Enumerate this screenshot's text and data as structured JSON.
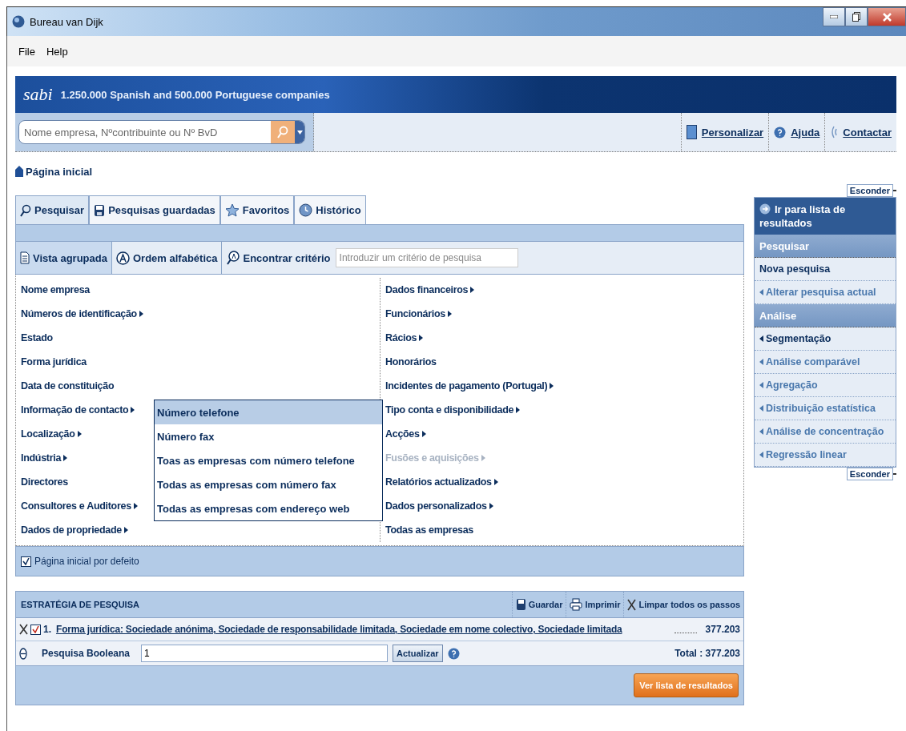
{
  "window": {
    "title": "Bureau van Dijk"
  },
  "menu": [
    "File",
    "Help"
  ],
  "banner": {
    "logo": "sabi",
    "tagline": "1.250.000 Spanish and 500.000 Portuguese companies"
  },
  "search": {
    "placeholder": "Nome empresa, Nºcontribuinte ou Nº BvD"
  },
  "header_links": [
    {
      "label": "Personalizar",
      "kind": "customize"
    },
    {
      "label": "Ajuda",
      "kind": "help"
    },
    {
      "label": "Contactar",
      "kind": "contact"
    }
  ],
  "breadcrumb": "Página inicial",
  "tabs": [
    {
      "label": "Pesquisar",
      "kind": "search",
      "selected": true
    },
    {
      "label": "Pesquisas guardadas",
      "kind": "saved",
      "selected": false
    },
    {
      "label": "Favoritos",
      "kind": "favorites",
      "selected": false
    },
    {
      "label": "Histórico",
      "kind": "history",
      "selected": false
    }
  ],
  "view_tabs": [
    {
      "label": "Vista agrupada",
      "kind": "grouped",
      "selected": true
    },
    {
      "label": "Ordem alfabética",
      "kind": "alpha",
      "selected": false
    }
  ],
  "find": {
    "label": "Encontrar critério",
    "placeholder": "Introduzir um critério de pesquisa"
  },
  "criteria_columns": [
    [
      {
        "label": "Nome empresa",
        "has_submenu": false,
        "disabled": false
      },
      {
        "label": "Números de identificação",
        "has_submenu": true,
        "disabled": false
      },
      {
        "label": "Estado",
        "has_submenu": false,
        "disabled": false
      },
      {
        "label": "Forma jurídica",
        "has_submenu": false,
        "disabled": false
      },
      {
        "label": "Data de constituição",
        "has_submenu": false,
        "disabled": false
      },
      {
        "label": "Informação de contacto",
        "has_submenu": true,
        "disabled": false,
        "submenu": [
          {
            "label": "Número telefone",
            "selected": true
          },
          {
            "label": "Número fax",
            "selected": false
          },
          {
            "label": "Toas as empresas com número telefone",
            "selected": false
          },
          {
            "label": "Todas as empresas com número fax",
            "selected": false
          },
          {
            "label": "Todas as empresas com endereço web",
            "selected": false
          }
        ]
      },
      {
        "label": "Localização",
        "has_submenu": true,
        "disabled": false
      },
      {
        "label": "Indústria",
        "has_submenu": true,
        "disabled": false
      },
      {
        "label": "Directores",
        "has_submenu": false,
        "disabled": false
      },
      {
        "label": "Consultores e Auditores",
        "has_submenu": true,
        "disabled": false
      },
      {
        "label": "Dados de propriedade",
        "has_submenu": true,
        "disabled": false
      }
    ],
    [
      {
        "label": "Dados financeiros",
        "has_submenu": true,
        "disabled": false
      },
      {
        "label": "Funcionários",
        "has_submenu": true,
        "disabled": false
      },
      {
        "label": "Rácios",
        "has_submenu": true,
        "disabled": false
      },
      {
        "label": "Honorários",
        "has_submenu": false,
        "disabled": false
      },
      {
        "label": "Incidentes de pagamento (Portugal)",
        "has_submenu": true,
        "disabled": false
      },
      {
        "label": "Tipo conta e disponibilidade",
        "has_submenu": true,
        "disabled": false
      },
      {
        "label": "Acções",
        "has_submenu": true,
        "disabled": false
      },
      {
        "label": "Fusões e aquisições",
        "has_submenu": true,
        "disabled": true
      },
      {
        "label": "Relatórios actualizados",
        "has_submenu": true,
        "disabled": false
      },
      {
        "label": "Dados personalizados",
        "has_submenu": true,
        "disabled": false
      },
      {
        "label": "Todas as empresas",
        "has_submenu": false,
        "disabled": false
      }
    ]
  ],
  "default_home": {
    "label": "Página inicial por defeito",
    "checked": true
  },
  "strategy": {
    "title": "ESTRATÉGIA DE PESQUISA",
    "actions": [
      {
        "label": "Guardar",
        "kind": "save"
      },
      {
        "label": "Imprimir",
        "kind": "print"
      },
      {
        "label": "Limpar todos os passos",
        "kind": "clear"
      }
    ],
    "steps": [
      {
        "number": "1.",
        "text": "Forma jurídica: Sociedade anónima, Sociedade de responsabilidade limitada, Sociedade em nome colectivo, Sociedade limitada",
        "count": "377.203",
        "checked": true
      }
    ],
    "boolean": {
      "label": "Pesquisa Booleana",
      "value": "1",
      "button": "Actualizar"
    },
    "total": "Total : 377.203",
    "results_button": "Ver lista de resultados"
  },
  "sidebar": {
    "hide_top": "Esconder",
    "go": "Ir para lista de resultados",
    "sections": [
      {
        "title": "Pesquisar",
        "items": [
          {
            "label": "Nova pesquisa",
            "arrow": false,
            "active": true
          },
          {
            "label": "Alterar pesquisa actual",
            "arrow": true,
            "active": false
          }
        ]
      },
      {
        "title": "Análise",
        "items": [
          {
            "label": "Segmentação",
            "arrow": true,
            "active": true
          },
          {
            "label": "Análise comparável",
            "arrow": true,
            "active": false
          },
          {
            "label": "Agregação",
            "arrow": true,
            "active": false
          },
          {
            "label": "Distribuição estatística",
            "arrow": true,
            "active": false
          },
          {
            "label": "Análise de concentração",
            "arrow": true,
            "active": false
          },
          {
            "label": "Regressão linear",
            "arrow": true,
            "active": false
          }
        ]
      }
    ],
    "hide_bottom": "Esconder"
  }
}
